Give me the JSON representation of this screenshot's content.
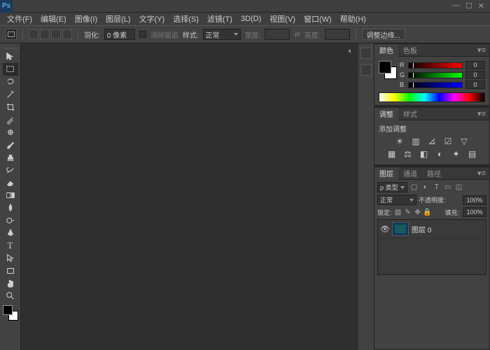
{
  "app": {
    "logo": "Ps"
  },
  "window_controls": {
    "minimize": "—",
    "maximize": "☐",
    "close": "✕"
  },
  "menu": [
    "文件(F)",
    "编辑(E)",
    "图像(I)",
    "图层(L)",
    "文字(Y)",
    "选择(S)",
    "滤镜(T)",
    "3D(D)",
    "视图(V)",
    "窗口(W)",
    "帮助(H)"
  ],
  "options": {
    "feather_label": "羽化:",
    "feather_value": "0 像素",
    "antialias_label": "消除锯齿",
    "style_label": "样式:",
    "style_value": "正常",
    "width_label": "宽度:",
    "height_label": "高度:",
    "refine_label": "调整边缘..."
  },
  "panels": {
    "color": {
      "tabs": [
        "颜色",
        "色板"
      ],
      "channels": [
        {
          "label": "R",
          "value": "0"
        },
        {
          "label": "G",
          "value": "0"
        },
        {
          "label": "B",
          "value": "0"
        }
      ]
    },
    "adjust": {
      "tabs": [
        "调整",
        "样式"
      ],
      "hint": "添加调整"
    },
    "layers": {
      "tabs": [
        "图层",
        "通道",
        "路径"
      ],
      "kind_label": "ρ 类型",
      "blend_value": "正常",
      "opacity_label": "不透明度:",
      "opacity_value": "100%",
      "lock_label": "锁定:",
      "fill_label": "填充:",
      "fill_value": "100%",
      "items": [
        {
          "name": "图层 0"
        }
      ]
    }
  }
}
